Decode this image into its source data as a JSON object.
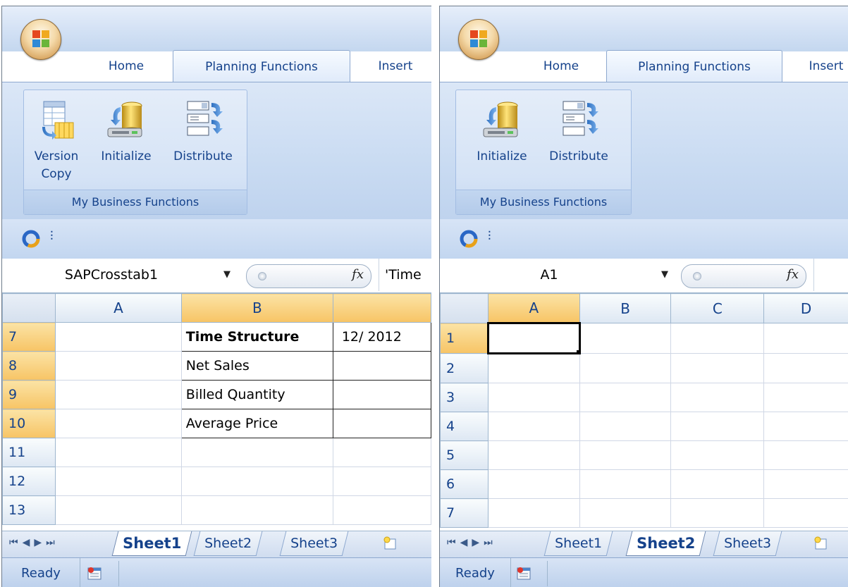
{
  "left": {
    "tabs": [
      "Home",
      "Planning Functions",
      "Insert"
    ],
    "active_tab": 1,
    "buttons": [
      {
        "label_line1": "Version",
        "label_line2": "Copy",
        "icon": "version-copy-icon"
      },
      {
        "label_line1": "Initialize",
        "label_line2": "",
        "icon": "initialize-icon"
      },
      {
        "label_line1": "Distribute",
        "label_line2": "",
        "icon": "distribute-icon"
      }
    ],
    "group_label": "My Business Functions",
    "name_box": "SAPCrosstab1",
    "formula_value": "'Time",
    "columns": [
      "A",
      "B",
      ""
    ],
    "rows": [
      "7",
      "8",
      "9",
      "10",
      "11",
      "12",
      "13"
    ],
    "crosstab": [
      [
        "Time Structure",
        "12/ 2012"
      ],
      [
        "Net Sales",
        ""
      ],
      [
        "Billed Quantity",
        ""
      ],
      [
        "Average Price",
        ""
      ]
    ],
    "sheets": [
      "Sheet1",
      "Sheet2",
      "Sheet3"
    ],
    "active_sheet": 0,
    "status": "Ready"
  },
  "right": {
    "tabs": [
      "Home",
      "Planning Functions",
      "Insert"
    ],
    "active_tab": 1,
    "buttons": [
      {
        "label_line1": "Initialize",
        "label_line2": "",
        "icon": "initialize-icon"
      },
      {
        "label_line1": "Distribute",
        "label_line2": "",
        "icon": "distribute-icon"
      }
    ],
    "group_label": "My Business Functions",
    "name_box": "A1",
    "formula_value": "",
    "columns": [
      "A",
      "B",
      "C",
      "D"
    ],
    "rows": [
      "1",
      "2",
      "3",
      "4",
      "5",
      "6",
      "7"
    ],
    "sheets": [
      "Sheet1",
      "Sheet2",
      "Sheet3"
    ],
    "active_sheet": 1,
    "status": "Ready"
  },
  "colors": {
    "ribbon_text": "#15428b",
    "selected_header": "#f7c465",
    "grid_line": "#d0d7e5"
  }
}
